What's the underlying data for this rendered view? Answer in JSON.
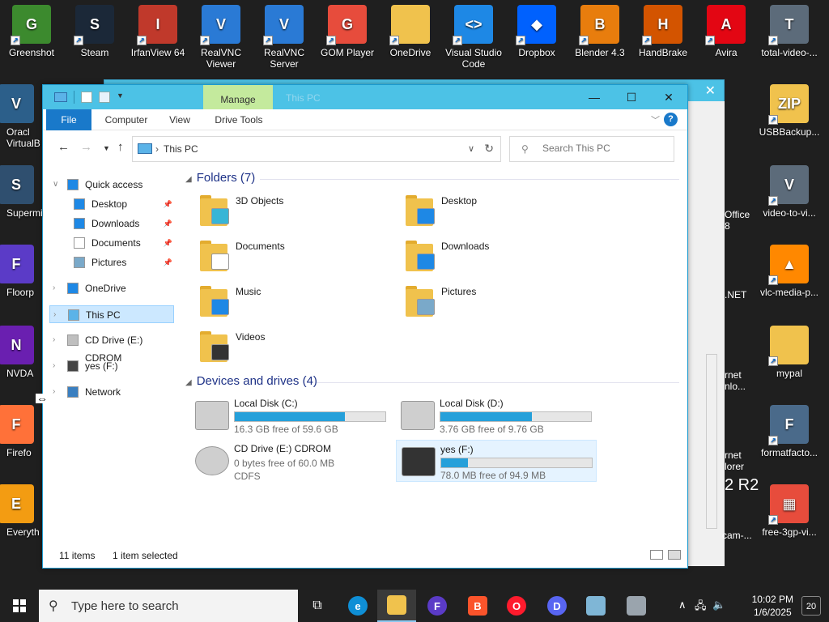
{
  "desktop": {
    "top_icons": [
      {
        "label": "Greenshot",
        "color": "#3c8a2e",
        "glyph": "G"
      },
      {
        "label": "Steam",
        "color": "#1b2838",
        "glyph": "S"
      },
      {
        "label": "IrfanView 64",
        "color": "#c0392b",
        "glyph": "I"
      },
      {
        "label": "RealVNC Viewer",
        "color": "#2a7ad5",
        "glyph": "V"
      },
      {
        "label": "RealVNC Server",
        "color": "#2a7ad5",
        "glyph": "V"
      },
      {
        "label": "GOM Player",
        "color": "#e74c3c",
        "glyph": "G"
      },
      {
        "label": "OneDrive",
        "color": "#f0c24d",
        "glyph": ""
      },
      {
        "label": "Visual Studio Code",
        "color": "#1e88e5",
        "glyph": "<>"
      },
      {
        "label": "Dropbox",
        "color": "#0061fe",
        "glyph": "◆"
      },
      {
        "label": "Blender 4.3",
        "color": "#e87d0d",
        "glyph": "B"
      },
      {
        "label": "HandBrake",
        "color": "#d35400",
        "glyph": "H"
      },
      {
        "label": "Avira",
        "color": "#e30613",
        "glyph": "A"
      },
      {
        "label": "total-video-...",
        "color": "#5c6b7a",
        "glyph": "T"
      }
    ],
    "left_icons": [
      {
        "label": "Oracl VirtualB",
        "color": "#2c5f8a",
        "glyph": "V"
      },
      {
        "label": "Supermi",
        "color": "#2f4f6f",
        "glyph": "S"
      },
      {
        "label": "Floorp",
        "color": "#5b3bc7",
        "glyph": "F"
      },
      {
        "label": "NVDA",
        "color": "#6a1fb0",
        "glyph": "N"
      },
      {
        "label": "Firefo",
        "color": "#ff7139",
        "glyph": "F"
      },
      {
        "label": "Everyth",
        "color": "#f39c12",
        "glyph": "E"
      }
    ],
    "right_icons": [
      {
        "label": "USBBackup...",
        "color": "#f0c24d",
        "glyph": "ZIP"
      },
      {
        "label": "video-to-vi...",
        "color": "#5c6b7a",
        "glyph": "V"
      },
      {
        "label": "vlc-media-p...",
        "color": "#ff8800",
        "glyph": "▲"
      },
      {
        "label": "mypal",
        "color": "#f0c24d",
        "glyph": ""
      },
      {
        "label": "formatfacto...",
        "color": "#4a6a8a",
        "glyph": "F"
      },
      {
        "label": "free-3gp-vi...",
        "color": "#e74c3c",
        "glyph": "▦"
      }
    ],
    "partial_labels": [
      "Office",
      "8",
      ".NET",
      "rnet",
      "nlo...",
      "rnet",
      "lorer",
      "2 R2",
      "cam-..."
    ]
  },
  "window": {
    "title": "This PC",
    "manage_tab": "Manage",
    "ribbon_tabs": [
      "File",
      "Computer",
      "View",
      "Drive Tools"
    ],
    "help": "?",
    "address": {
      "crumb": "This PC"
    },
    "search_placeholder": "Search This PC",
    "sidebar": [
      {
        "label": "Quick access",
        "level": 0,
        "expanded": true
      },
      {
        "label": "Desktop",
        "level": 1,
        "pinned": true
      },
      {
        "label": "Downloads",
        "level": 1,
        "pinned": true
      },
      {
        "label": "Documents",
        "level": 1,
        "pinned": true
      },
      {
        "label": "Pictures",
        "level": 1,
        "pinned": true
      },
      {
        "label": "OneDrive",
        "level": 0
      },
      {
        "label": "This PC",
        "level": 0,
        "selected": true
      },
      {
        "label": "CD Drive (E:) CDROM",
        "level": 0
      },
      {
        "label": "yes (F:)",
        "level": 0
      },
      {
        "label": "Network",
        "level": 0
      }
    ],
    "folders_header": "Folders (7)",
    "folders": [
      {
        "name": "3D Objects",
        "overlay": "#37b5d6"
      },
      {
        "name": "Desktop",
        "overlay": "#1e88e5"
      },
      {
        "name": "Documents",
        "overlay": "#ffffff"
      },
      {
        "name": "Downloads",
        "overlay": "#1e88e5"
      },
      {
        "name": "Music",
        "overlay": "#1e88e5"
      },
      {
        "name": "Pictures",
        "overlay": "#7aa9c9"
      },
      {
        "name": "Videos",
        "overlay": "#333333"
      }
    ],
    "drives_header": "Devices and drives (4)",
    "drives": [
      {
        "name": "Local Disk (C:)",
        "free": "16.3 GB free of 59.6 GB",
        "used_fraction": 0.73,
        "bar": true
      },
      {
        "name": "Local Disk (D:)",
        "free": "3.76 GB free of 9.76 GB",
        "used_fraction": 0.61,
        "bar": true
      },
      {
        "name": "CD Drive (E:) CDROM",
        "free": "0 bytes free of 60.0 MB",
        "fs": "CDFS",
        "bar": false
      },
      {
        "name": "yes (F:)",
        "free": "78.0 MB free of 94.9 MB",
        "used_fraction": 0.18,
        "bar": true,
        "selected": true
      }
    ],
    "status": {
      "items": "11 items",
      "selected": "1 item selected"
    }
  },
  "taskbar": {
    "search_placeholder": "Type here to search",
    "time": "10:02 PM",
    "date": "1/6/2025",
    "notifications": "20"
  }
}
